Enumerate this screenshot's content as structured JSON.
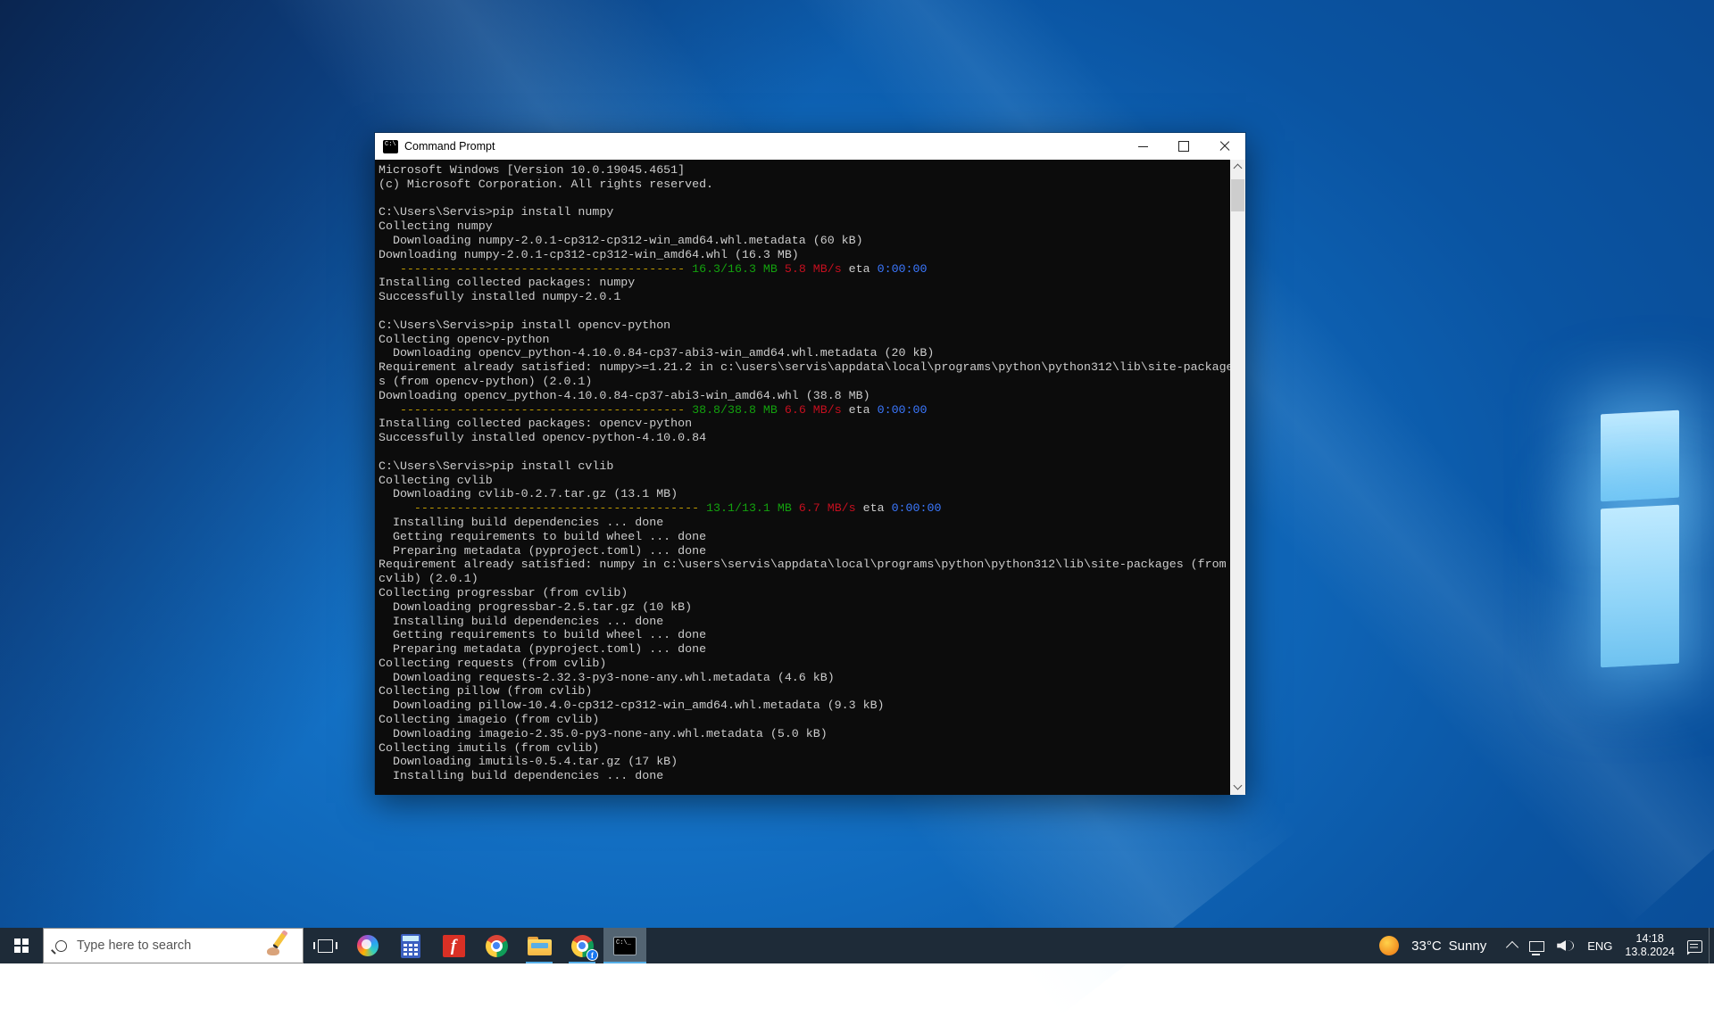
{
  "colors": {
    "term-bg": "#0c0c0c",
    "term-fg": "#cccccc",
    "ansi-yellow": "#c19c00",
    "ansi-green": "#13a10e",
    "ansi-red": "#c50f1f",
    "ansi-blue": "#3b78ff",
    "taskbar-bg": "#1e2b38",
    "underline": "#55aee8",
    "accent": "#0078d7"
  },
  "window": {
    "title": "Command Prompt",
    "window_icon": "command-prompt-icon",
    "controls": [
      "minimize-icon",
      "maximize-icon",
      "close-icon"
    ]
  },
  "terminal": {
    "lines": [
      "Microsoft Windows [Version 10.0.19045.4651]",
      "(c) Microsoft Corporation. All rights reserved.",
      "",
      "C:\\Users\\Servis>pip install numpy",
      "Collecting numpy",
      "  Downloading numpy-2.0.1-cp312-cp312-win_amd64.whl.metadata (60 kB)",
      "Downloading numpy-2.0.1-cp312-cp312-win_amd64.whl (16.3 MB)",
      [
        {
          "t": "   "
        },
        {
          "t": "----------------------------------------",
          "c": "y"
        },
        {
          "t": " 16.3/16.3 MB",
          "c": "g"
        },
        {
          "t": " 5.8 MB/s",
          "c": "r"
        },
        {
          "t": " eta "
        },
        {
          "t": "0:00:00",
          "c": "b"
        }
      ],
      "Installing collected packages: numpy",
      "Successfully installed numpy-2.0.1",
      "",
      "C:\\Users\\Servis>pip install opencv-python",
      "Collecting opencv-python",
      "  Downloading opencv_python-4.10.0.84-cp37-abi3-win_amd64.whl.metadata (20 kB)",
      "Requirement already satisfied: numpy>=1.21.2 in c:\\users\\servis\\appdata\\local\\programs\\python\\python312\\lib\\site-package",
      "s (from opencv-python) (2.0.1)",
      "Downloading opencv_python-4.10.0.84-cp37-abi3-win_amd64.whl (38.8 MB)",
      [
        {
          "t": "   "
        },
        {
          "t": "----------------------------------------",
          "c": "y"
        },
        {
          "t": " 38.8/38.8 MB",
          "c": "g"
        },
        {
          "t": " 6.6 MB/s",
          "c": "r"
        },
        {
          "t": " eta "
        },
        {
          "t": "0:00:00",
          "c": "b"
        }
      ],
      "Installing collected packages: opencv-python",
      "Successfully installed opencv-python-4.10.0.84",
      "",
      "C:\\Users\\Servis>pip install cvlib",
      "Collecting cvlib",
      "  Downloading cvlib-0.2.7.tar.gz (13.1 MB)",
      [
        {
          "t": "     "
        },
        {
          "t": "----------------------------------------",
          "c": "y"
        },
        {
          "t": " 13.1/13.1 MB",
          "c": "g"
        },
        {
          "t": " 6.7 MB/s",
          "c": "r"
        },
        {
          "t": " eta "
        },
        {
          "t": "0:00:00",
          "c": "b"
        }
      ],
      "  Installing build dependencies ... done",
      "  Getting requirements to build wheel ... done",
      "  Preparing metadata (pyproject.toml) ... done",
      "Requirement already satisfied: numpy in c:\\users\\servis\\appdata\\local\\programs\\python\\python312\\lib\\site-packages (from",
      "cvlib) (2.0.1)",
      "Collecting progressbar (from cvlib)",
      "  Downloading progressbar-2.5.tar.gz (10 kB)",
      "  Installing build dependencies ... done",
      "  Getting requirements to build wheel ... done",
      "  Preparing metadata (pyproject.toml) ... done",
      "Collecting requests (from cvlib)",
      "  Downloading requests-2.32.3-py3-none-any.whl.metadata (4.6 kB)",
      "Collecting pillow (from cvlib)",
      "  Downloading pillow-10.4.0-cp312-cp312-win_amd64.whl.metadata (9.3 kB)",
      "Collecting imageio (from cvlib)",
      "  Downloading imageio-2.35.0-py3-none-any.whl.metadata (5.0 kB)",
      "Collecting imutils (from cvlib)",
      "  Downloading imutils-0.5.4.tar.gz (17 kB)",
      "  Installing build dependencies ... done"
    ]
  },
  "taskbar": {
    "search": {
      "placeholder": "Type here to search"
    },
    "app_icons": [
      "start-icon",
      "task-view-icon",
      "copilot-icon",
      "calculator-icon",
      "facebook-app-icon",
      "chrome-icon",
      "file-explorer-icon",
      "chrome-facebook-icon",
      "command-prompt-icon"
    ],
    "running_apps": [
      "file-explorer",
      "chrome-facebook",
      "command-prompt"
    ],
    "active_app": "command-prompt",
    "tray": {
      "weather_temp": "33°C",
      "weather_condition": "Sunny",
      "tray_icons": [
        "weather-sun-icon",
        "chevron-up-icon",
        "network-icon",
        "volume-icon",
        "action-center-icon"
      ],
      "language": "ENG",
      "time": "14:18",
      "date": "13.8.2024"
    }
  }
}
